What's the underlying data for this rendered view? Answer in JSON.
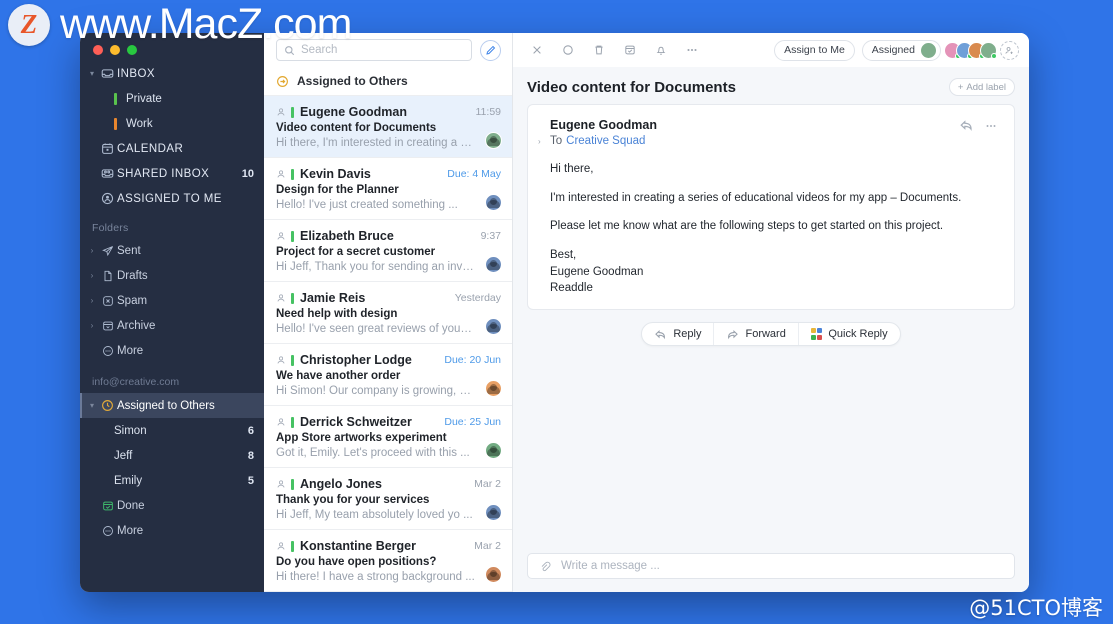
{
  "watermarks": {
    "top": "www.MacZ.com",
    "logo": "Z",
    "bottom": "@51CTO博客"
  },
  "sidebar": {
    "main": [
      {
        "label": "INBOX",
        "icon": "inbox-icon",
        "caret": true,
        "count": ""
      },
      {
        "label": "Private",
        "icon": "flag-green",
        "sub": true,
        "flag": "#59c34d"
      },
      {
        "label": "Work",
        "icon": "flag-orange",
        "sub": true,
        "flag": "#e8862e"
      },
      {
        "label": "CALENDAR",
        "icon": "calendar-icon",
        "count": ""
      },
      {
        "label": "SHARED INBOX",
        "icon": "shared-inbox-icon",
        "count": "10"
      },
      {
        "label": "ASSIGNED TO ME",
        "icon": "assigned-icon",
        "count": ""
      }
    ],
    "folders_title": "Folders",
    "folders": [
      {
        "label": "Sent",
        "icon": "send-icon",
        "caret": true
      },
      {
        "label": "Drafts",
        "icon": "draft-icon",
        "caret": true
      },
      {
        "label": "Spam",
        "icon": "spam-icon",
        "caret": true
      },
      {
        "label": "Archive",
        "icon": "archive-icon",
        "caret": true
      },
      {
        "label": "More",
        "icon": "more-circle-icon",
        "caret": false
      }
    ],
    "account": "info@creative.com",
    "assigned_group": {
      "label": "Assigned to Others",
      "icon": "assigned-others-icon"
    },
    "people": [
      {
        "label": "Simon",
        "count": "6"
      },
      {
        "label": "Jeff",
        "count": "8"
      },
      {
        "label": "Emily",
        "count": "5"
      }
    ],
    "bottom": [
      {
        "label": "Done",
        "icon": "done-icon"
      },
      {
        "label": "More",
        "icon": "more-circle-icon"
      }
    ]
  },
  "search": {
    "placeholder": "Search",
    "value": ""
  },
  "list_header": {
    "title": "Assigned to Others"
  },
  "messages": [
    {
      "name": "Eugene Goodman",
      "time": "11:59",
      "due": false,
      "subject": "Video content for Documents",
      "preview": "Hi there, I'm interested in creating a series",
      "active": true,
      "avatar": "#7fae8c"
    },
    {
      "name": "Kevin Davis",
      "time": "Due: 4 May",
      "due": true,
      "subject": "Design for the Planner",
      "preview": "Hello! I've just created something ...",
      "active": false,
      "avatar": "#6f8fbe"
    },
    {
      "name": "Elizabeth Bruce",
      "time": "9:37",
      "due": false,
      "subject": "Project for a secret customer",
      "preview": "Hi Jeff, Thank you for sending an invoice",
      "active": false,
      "avatar": "#6f8fbe"
    },
    {
      "name": "Jamie Reis",
      "time": "Yesterday",
      "due": false,
      "subject": "Need help with design",
      "preview": "Hello! I've seen great reviews of your ...",
      "active": false,
      "avatar": "#6f8fbe"
    },
    {
      "name": "Christopher Lodge",
      "time": "Due: 20 Jun",
      "due": true,
      "subject": "We have another order",
      "preview": "Hi Simon! Our company is growing, so ...",
      "active": false,
      "avatar": "#e8a065"
    },
    {
      "name": "Derrick Schweitzer",
      "time": "Due: 25 Jun",
      "due": true,
      "subject": "App Store artworks experiment",
      "preview": "Got it, Emily. Let's proceed with this ...",
      "active": false,
      "avatar": "#72ab82"
    },
    {
      "name": "Angelo Jones",
      "time": "Mar 2",
      "due": false,
      "subject": "Thank you for your services",
      "preview": "Hi Jeff, My team absolutely loved yo ...",
      "active": false,
      "avatar": "#6f8fbe"
    },
    {
      "name": "Konstantine Berger",
      "time": "Mar 2",
      "due": false,
      "subject": "Do you have open positions?",
      "preview": "Hi there! I have a strong background ...",
      "active": false,
      "avatar": "#d08a5e"
    }
  ],
  "toolbar": {
    "close": "close-icon",
    "snooze": "circle-icon",
    "delete": "trash-icon",
    "archive": "archive-icon",
    "remind": "bell-icon",
    "more": "more-dots-icon",
    "assign_to_me": "Assign to Me",
    "assigned": "Assigned"
  },
  "pane": {
    "subject": "Video content for Documents",
    "add_label": "Add label",
    "from": "Eugene Goodman",
    "to_prefix": "To",
    "to": "Creative Squad",
    "body": [
      "Hi there,",
      "I'm interested in creating a series of educational videos for my app – Documents.",
      "Please let me know what are the following steps to get started on this project."
    ],
    "signature": [
      "Best,",
      "Eugene Goodman",
      "Readdle"
    ]
  },
  "reply_bar": {
    "reply": "Reply",
    "forward": "Forward",
    "quick_reply": "Quick Reply",
    "quick_colors": [
      "#e8b63a",
      "#4a82d8",
      "#3fb24f",
      "#d94f4f"
    ]
  },
  "composer": {
    "placeholder": "Write a message ..."
  },
  "colors": {
    "accent": "#3b82e8",
    "sidebar_bg": "#252e42",
    "selected_row": "#e8f1fc",
    "desktop": "#2f74e8",
    "green_flag": "#46c263"
  }
}
